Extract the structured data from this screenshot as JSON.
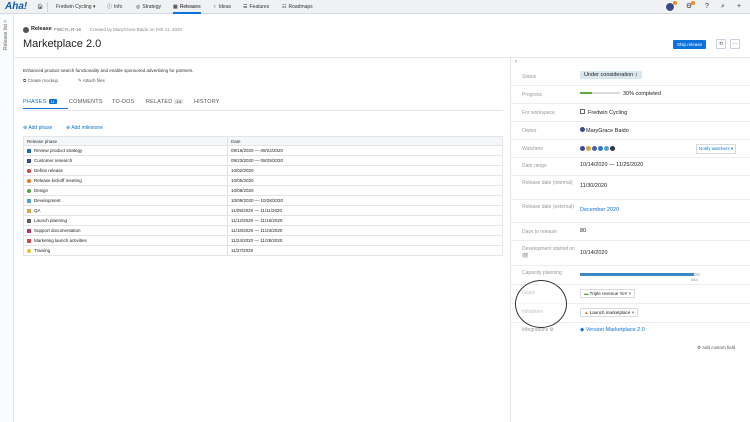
{
  "topbar": {
    "logo": "Aha!",
    "home_icon": "home-icon",
    "workspace": "Fredwin Cycling ▾",
    "info": "Info",
    "strategy": "Strategy",
    "releases": "Releases",
    "ideas": "Ideas",
    "features": "Features",
    "roadmaps": "Roadmaps"
  },
  "leftstrip": {
    "label": "Release list >"
  },
  "header": {
    "type_label": "Release",
    "release_id": "FWCYL-R-16",
    "created": "Created by MaryGrace Baido on Feb 11, 2020",
    "title": "Marketplace 2.0",
    "ship_label": "Ship release",
    "history_icon": "⟲",
    "more_icon": "···"
  },
  "main": {
    "description": "Enhanced product search functionality and enable sponsored advertising for partners.",
    "create_mockup": "Create mockup",
    "attach_files": "Attach files",
    "tabs": {
      "phases": "PHASES",
      "phases_count": "11",
      "comments": "COMMENTS",
      "todos": "TO-DOS",
      "related": "RELATED",
      "related_count": "14",
      "history": "HISTORY"
    },
    "add_phase": "Add phase",
    "add_milestone": "Add milestone",
    "table": {
      "col_phase": "Release phase",
      "col_date": "Date",
      "rows": [
        {
          "name": "Review product strategy",
          "date": "09/16/2020  —  09/22/2020",
          "color": "#1f6fb8",
          "shape": "square"
        },
        {
          "name": "Customer research",
          "date": "09/23/2020  —  09/29/2020",
          "color": "#3b4a8a",
          "shape": "square"
        },
        {
          "name": "Define release",
          "date": "10/02/2020",
          "color": "#d23f3f",
          "shape": "circle"
        },
        {
          "name": "Release kickoff meeting",
          "date": "10/05/2020",
          "color": "#e8771f",
          "shape": "circle"
        },
        {
          "name": "Design",
          "date": "10/08/2020",
          "color": "#55a63a",
          "shape": "circle"
        },
        {
          "name": "Development",
          "date": "10/09/2020  —  10/28/2020",
          "color": "#4ba3c7",
          "shape": "square"
        },
        {
          "name": "QA",
          "date": "11/09/2020  —  11/11/2020",
          "color": "#d9a441",
          "shape": "square"
        },
        {
          "name": "Launch planning",
          "date": "11/12/2020  —  11/16/2020",
          "color": "#5c5c66",
          "shape": "square"
        },
        {
          "name": "Support documentation",
          "date": "11/18/2020  —  11/23/2020",
          "color": "#b23a6b",
          "shape": "square"
        },
        {
          "name": "Marketing launch activities",
          "date": "11/24/2020  —  11/28/2020",
          "color": "#d64646",
          "shape": "square"
        },
        {
          "name": "Training",
          "date": "11/27/2020",
          "color": "#e6c227",
          "shape": "circle"
        }
      ]
    }
  },
  "side": {
    "status_label": "Status",
    "status_value": "Under consideration ↕",
    "progress_label": "Progress",
    "progress_value": "30% completed",
    "progress_fraction": 0.3,
    "workspace_label": "For workspace",
    "workspace_value": "Fredwin Cycling",
    "owner_label": "Owner",
    "owner_value": "MaryGrace Baido",
    "watchers_label": "Watchers",
    "notify_label": "Notify watchers ▾",
    "date_range_label": "Date range",
    "date_range_value": "10/14/2020  —  11/25/2020",
    "internal_label": "Release date (internal)",
    "internal_value": "11/30/2020",
    "external_label": "Release date (external)",
    "external_value": "December 2020",
    "days_label": "Days to release",
    "days_value": "80",
    "dev_label": "Development started on 🗓",
    "dev_value": "10/14/2020",
    "capacity_label": "Capacity planning",
    "capacity_fraction": 0.95,
    "capacity_sub": "88d",
    "goals_label": "Goals",
    "goals_value": "Triple revenue YoY",
    "initiatives_label": "Initiatives",
    "initiatives_value": "Launch marketplace",
    "integrations_label": "Integrations ⚙",
    "integrations_value": "Version Marketplace 2.0",
    "add_custom": "Add custom field"
  },
  "colors": {
    "accent": "#0b73d9",
    "progress": "#5aab3c",
    "capacity": "#3d86c8"
  }
}
